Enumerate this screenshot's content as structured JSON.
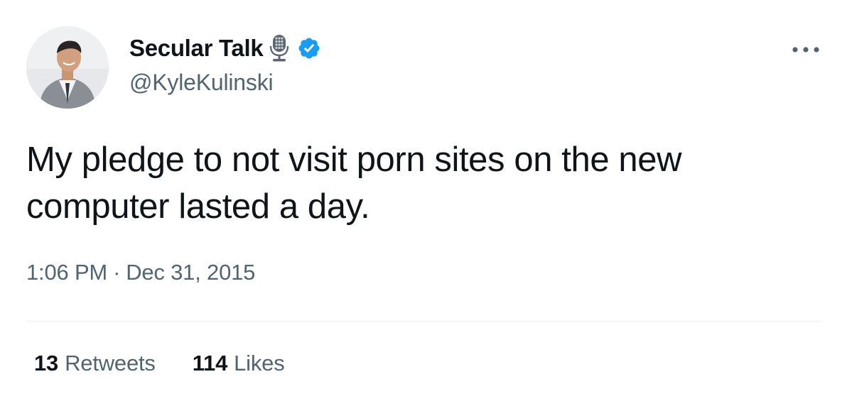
{
  "author": {
    "display_name": "Secular Talk",
    "handle": "@KyleKulinski",
    "verified": true,
    "name_emoji": "studio-microphone-icon",
    "avatar": "avatar-photo"
  },
  "tweet": {
    "text": "My pledge to not visit porn sites on the new computer lasted a day.",
    "time": "1:06 PM",
    "separator": "·",
    "date": "Dec 31, 2015"
  },
  "stats": {
    "retweets_count": "13",
    "retweets_label": "Retweets",
    "likes_count": "114",
    "likes_label": "Likes"
  },
  "colors": {
    "text_primary": "#0f1419",
    "text_secondary": "#536471",
    "verified_blue": "#1d9bf0",
    "divider": "#eff3f4"
  },
  "icons": {
    "more": "more-options-icon",
    "verified": "verified-badge-icon"
  }
}
